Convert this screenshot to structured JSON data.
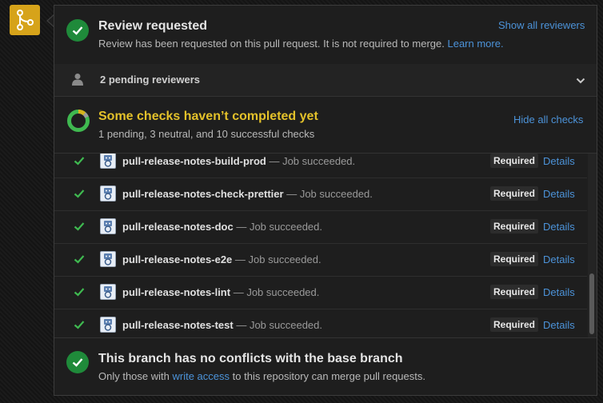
{
  "colors": {
    "success_green": "#1f8a3a",
    "check_green": "#3fb950",
    "link_blue": "#4c93d9",
    "pending_yellow": "#d6b41c",
    "merge_badge": "#d6a31a"
  },
  "review": {
    "title": "Review requested",
    "subtitle": "Review has been requested on this pull request. It is not required to merge.",
    "learn_more": "Learn more.",
    "show_all": "Show all reviewers"
  },
  "pending": {
    "label": "2 pending reviewers"
  },
  "checks": {
    "title": "Some checks haven’t completed yet",
    "summary": "1 pending, 3 neutral, and 10 successful checks",
    "hide_all": "Hide all checks",
    "required_label": "Required",
    "details_label": "Details",
    "items": [
      {
        "name": "pull-release-notes-build-prod",
        "desc": "— Job succeeded."
      },
      {
        "name": "pull-release-notes-check-prettier",
        "desc": "— Job succeeded."
      },
      {
        "name": "pull-release-notes-doc",
        "desc": "— Job succeeded."
      },
      {
        "name": "pull-release-notes-e2e",
        "desc": "— Job succeeded."
      },
      {
        "name": "pull-release-notes-lint",
        "desc": "— Job succeeded."
      },
      {
        "name": "pull-release-notes-test",
        "desc": "— Job succeeded."
      }
    ]
  },
  "branch": {
    "title": "This branch has no conflicts with the base branch",
    "subtitle_pre": "Only those with",
    "write_access": "write access",
    "subtitle_post": "to this repository can merge pull requests."
  }
}
